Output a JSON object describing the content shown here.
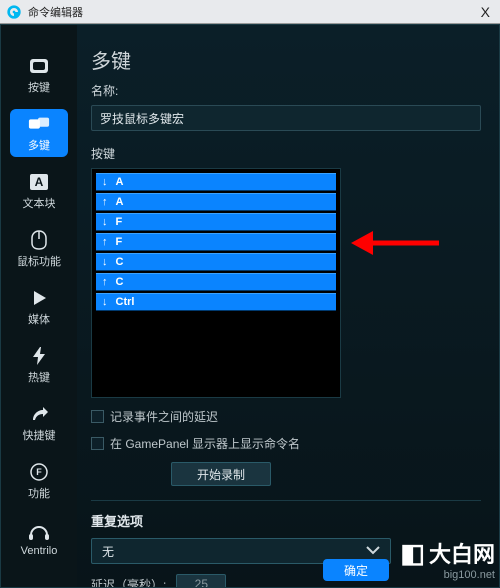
{
  "titlebar": {
    "title": "命令编辑器",
    "close_label": "X"
  },
  "sidebar": {
    "items": [
      {
        "id": "keys",
        "label": "按键",
        "active": false
      },
      {
        "id": "multikey",
        "label": "多键",
        "active": true
      },
      {
        "id": "text",
        "label": "文本块",
        "active": false
      },
      {
        "id": "mouse",
        "label": "鼠标功能",
        "active": false
      },
      {
        "id": "media",
        "label": "媒体",
        "active": false
      },
      {
        "id": "hotkey",
        "label": "热键",
        "active": false
      },
      {
        "id": "shortcut",
        "label": "快捷键",
        "active": false
      },
      {
        "id": "function",
        "label": "功能",
        "active": false
      },
      {
        "id": "ventrilo",
        "label": "Ventrilo",
        "active": false
      }
    ]
  },
  "main": {
    "heading": "多键",
    "name_label": "名称:",
    "name_value": "罗技鼠标多键宏",
    "keys_label": "按键",
    "key_rows": [
      {
        "dir": "down",
        "key": "A"
      },
      {
        "dir": "up",
        "key": "A"
      },
      {
        "dir": "down",
        "key": "F"
      },
      {
        "dir": "up",
        "key": "F"
      },
      {
        "dir": "down",
        "key": "C"
      },
      {
        "dir": "up",
        "key": "C"
      },
      {
        "dir": "down",
        "key": "Ctrl"
      }
    ],
    "chk_record_delay": "记录事件之间的延迟",
    "chk_gamepanel": "在 GamePanel 显示器上显示命令名",
    "start_record": "开始录制",
    "repeat_heading": "重复选项",
    "repeat_select": "无",
    "delay_label": "延迟（毫秒）:",
    "delay_value": "25",
    "confirm": "确定"
  },
  "watermark": {
    "brand_cn": "大白网",
    "url": "big100.net"
  }
}
